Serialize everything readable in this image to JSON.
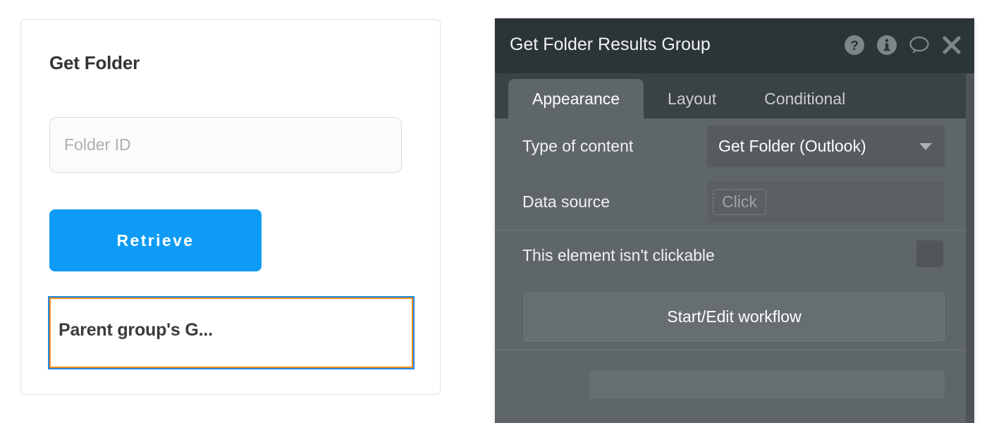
{
  "preview": {
    "title": "Get Folder",
    "folder_id_input": {
      "placeholder": "Folder ID",
      "value": ""
    },
    "retrieve_button_label": "Retrieve",
    "selected_group_label": "Parent group's G...",
    "selection_outer_color": "#2189e8",
    "selection_inner_color": "#f08c1a",
    "accent_color": "#0d9bf5"
  },
  "panel": {
    "title": "Get Folder Results Group",
    "header_icons": [
      {
        "name": "help-icon",
        "glyph": "?"
      },
      {
        "name": "info-icon",
        "glyph": "i"
      },
      {
        "name": "comment-icon",
        "glyph": "speech-bubble"
      },
      {
        "name": "close-icon",
        "glyph": "X"
      }
    ],
    "tabs": [
      {
        "label": "Appearance",
        "active": true
      },
      {
        "label": "Layout",
        "active": false
      },
      {
        "label": "Conditional",
        "active": false
      }
    ],
    "fields": {
      "type_of_content": {
        "label": "Type of content",
        "value": "Get Folder (Outlook)"
      },
      "data_source": {
        "label": "Data source",
        "placeholder": "Click"
      }
    },
    "clickable": {
      "label": "This element isn't clickable",
      "checked": false
    },
    "workflow_button_label": "Start/Edit workflow",
    "header_bg": "#2b3436",
    "body_bg": "#5f666a"
  }
}
